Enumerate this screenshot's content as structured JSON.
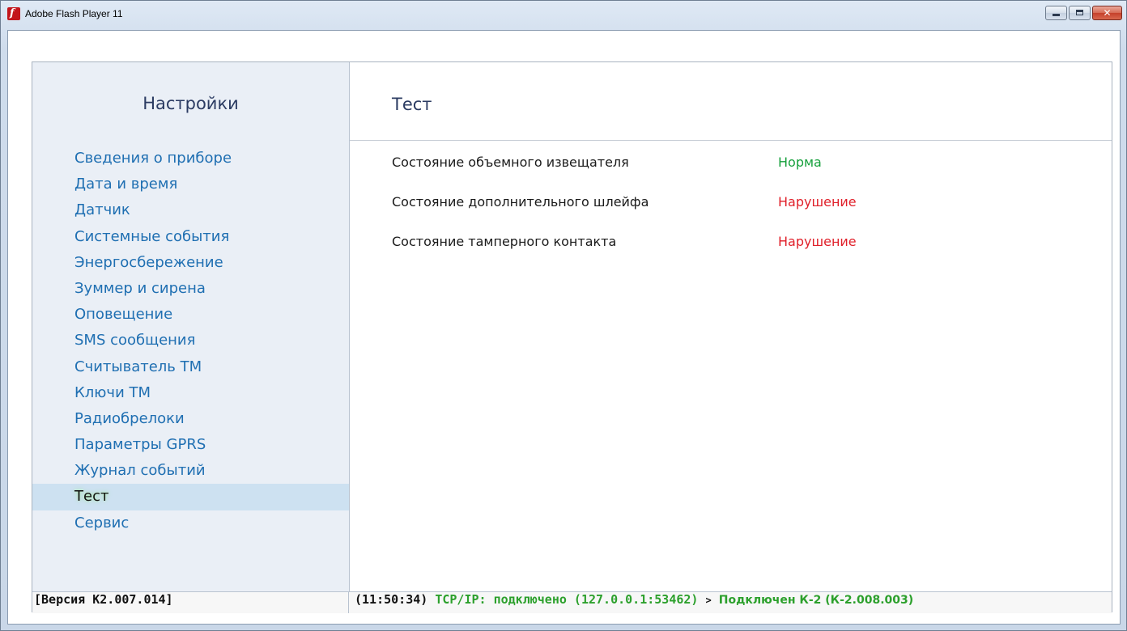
{
  "window": {
    "title": "Adobe Flash Player 11",
    "app_icon": "flash-player-icon",
    "app_icon_glyph": "f",
    "controls": {
      "minimize": "minimize-icon",
      "maximize": "maximize-icon",
      "close": "close-icon",
      "close_glyph": "✕"
    }
  },
  "sidebar": {
    "title": "Настройки",
    "items": [
      {
        "label": "Сведения о приборе"
      },
      {
        "label": "Дата и время"
      },
      {
        "label": "Датчик"
      },
      {
        "label": "Системные события"
      },
      {
        "label": "Энергосбережение"
      },
      {
        "label": "Зуммер и сирена"
      },
      {
        "label": "Оповещение"
      },
      {
        "label": "SMS сообщения"
      },
      {
        "label": "Считыватель ТМ"
      },
      {
        "label": "Ключи ТМ"
      },
      {
        "label": "Радиобрелоки"
      },
      {
        "label": "Параметры GPRS"
      },
      {
        "label": "Журнал событий"
      },
      {
        "label": "Тест",
        "active": true
      },
      {
        "label": "Сервис"
      }
    ]
  },
  "main": {
    "title": "Тест",
    "rows": [
      {
        "label": "Состояние объемного извещателя",
        "value": "Норма",
        "color": "#16a03c"
      },
      {
        "label": "Состояние дополнительного шлейфа",
        "value": "Нарушение",
        "color": "#e0202a"
      },
      {
        "label": "Состояние тамперного контакта",
        "value": "Нарушение",
        "color": "#e0202a"
      }
    ]
  },
  "statusbar": {
    "version": "[Версия К2.007.014]",
    "time": "(11:50:34)",
    "connection": "TCP/IP: подключено (127.0.0.1:53462)",
    "arrow": ">",
    "device": "Подключен К-2 (К-2.008.003)"
  },
  "colors": {
    "accent_link": "#1f6fb2",
    "ok": "#16a03c",
    "alarm": "#e0202a",
    "status_green": "#2ca02c",
    "selection": "#cde1f1"
  }
}
